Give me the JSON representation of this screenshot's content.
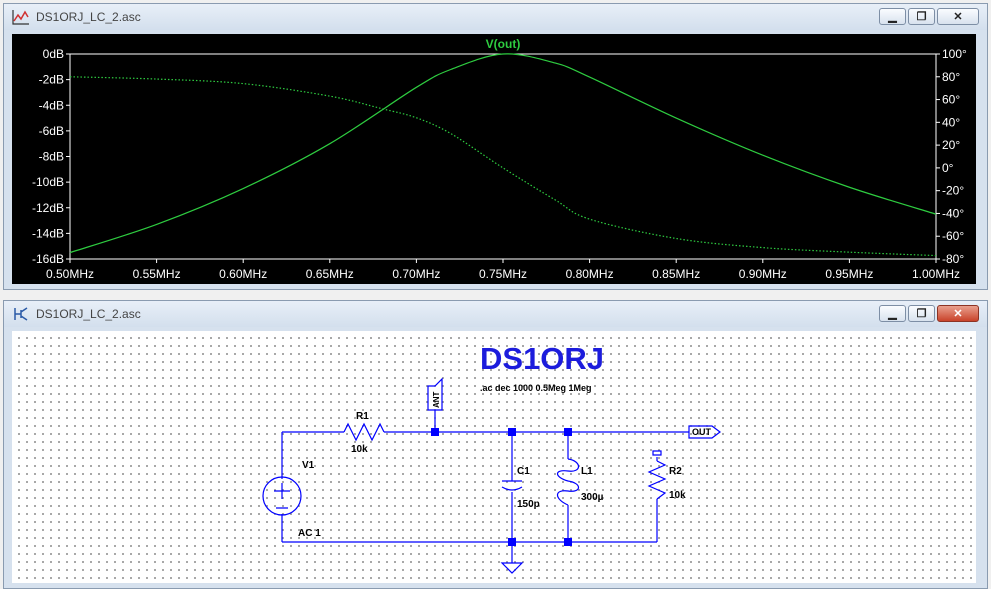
{
  "colors": {
    "trace": "#2ecc40",
    "wire": "#0000ff",
    "schem_text": "#000000",
    "title_big": "#0000ff"
  },
  "plot_window": {
    "title": "DS1ORJ_LC_2.asc",
    "icon": "waveform-icon",
    "trace_label": "V(out)",
    "left_axis_ticks": [
      "0dB",
      "-2dB",
      "-4dB",
      "-6dB",
      "-8dB",
      "-10dB",
      "-12dB",
      "-14dB",
      "-16dB"
    ],
    "right_axis_ticks": [
      "100°",
      "80°",
      "60°",
      "40°",
      "20°",
      "0°",
      "-20°",
      "-40°",
      "-60°",
      "-80°"
    ],
    "x_axis_ticks": [
      "0.50MHz",
      "0.55MHz",
      "0.60MHz",
      "0.65MHz",
      "0.70MHz",
      "0.75MHz",
      "0.80MHz",
      "0.85MHz",
      "0.90MHz",
      "0.95MHz",
      "1.00MHz"
    ]
  },
  "chart_data": {
    "type": "line",
    "xlabel": "",
    "x_unit": "MHz",
    "xlim": [
      0.5,
      1.0
    ],
    "ylim_left_db": [
      -16,
      0
    ],
    "ylim_right_deg": [
      -80,
      100
    ],
    "grid": false,
    "series": [
      {
        "name": "V(out)",
        "axis": "left",
        "style": "solid",
        "x": [
          0.5,
          0.55,
          0.6,
          0.65,
          0.7,
          0.72,
          0.75,
          0.78,
          0.8,
          0.85,
          0.9,
          0.95,
          1.0
        ],
        "y": [
          -15.5,
          -13.3,
          -10.5,
          -7.0,
          -2.6,
          -1.2,
          0.0,
          -0.7,
          -1.8,
          -5.0,
          -7.9,
          -10.4,
          -12.5
        ]
      },
      {
        "axis": "right",
        "style": "dotted",
        "x": [
          0.5,
          0.55,
          0.6,
          0.65,
          0.68,
          0.7,
          0.72,
          0.75,
          0.78,
          0.8,
          0.85,
          0.9,
          0.95,
          1.0
        ],
        "y": [
          80,
          78,
          74,
          63,
          52,
          44,
          30,
          0,
          -28,
          -45,
          -62,
          -70,
          -74,
          -77
        ]
      }
    ]
  },
  "schematic_window": {
    "title": "DS1ORJ_LC_2.asc",
    "icon": "schematic-icon",
    "heading": "DS1ORJ",
    "directive": ".ac dec 1000 0.5Meg 1Meg",
    "components": {
      "r1_name": "R1",
      "r1_value": "10k",
      "v1_name": "V1",
      "v1_value": "AC 1",
      "c1_name": "C1",
      "c1_value": "150p",
      "l1_name": "L1",
      "l1_value": "300µ",
      "r2_name": "R2",
      "r2_value": "10k"
    },
    "labels": {
      "ant": "ANT",
      "out": "OUT"
    }
  }
}
